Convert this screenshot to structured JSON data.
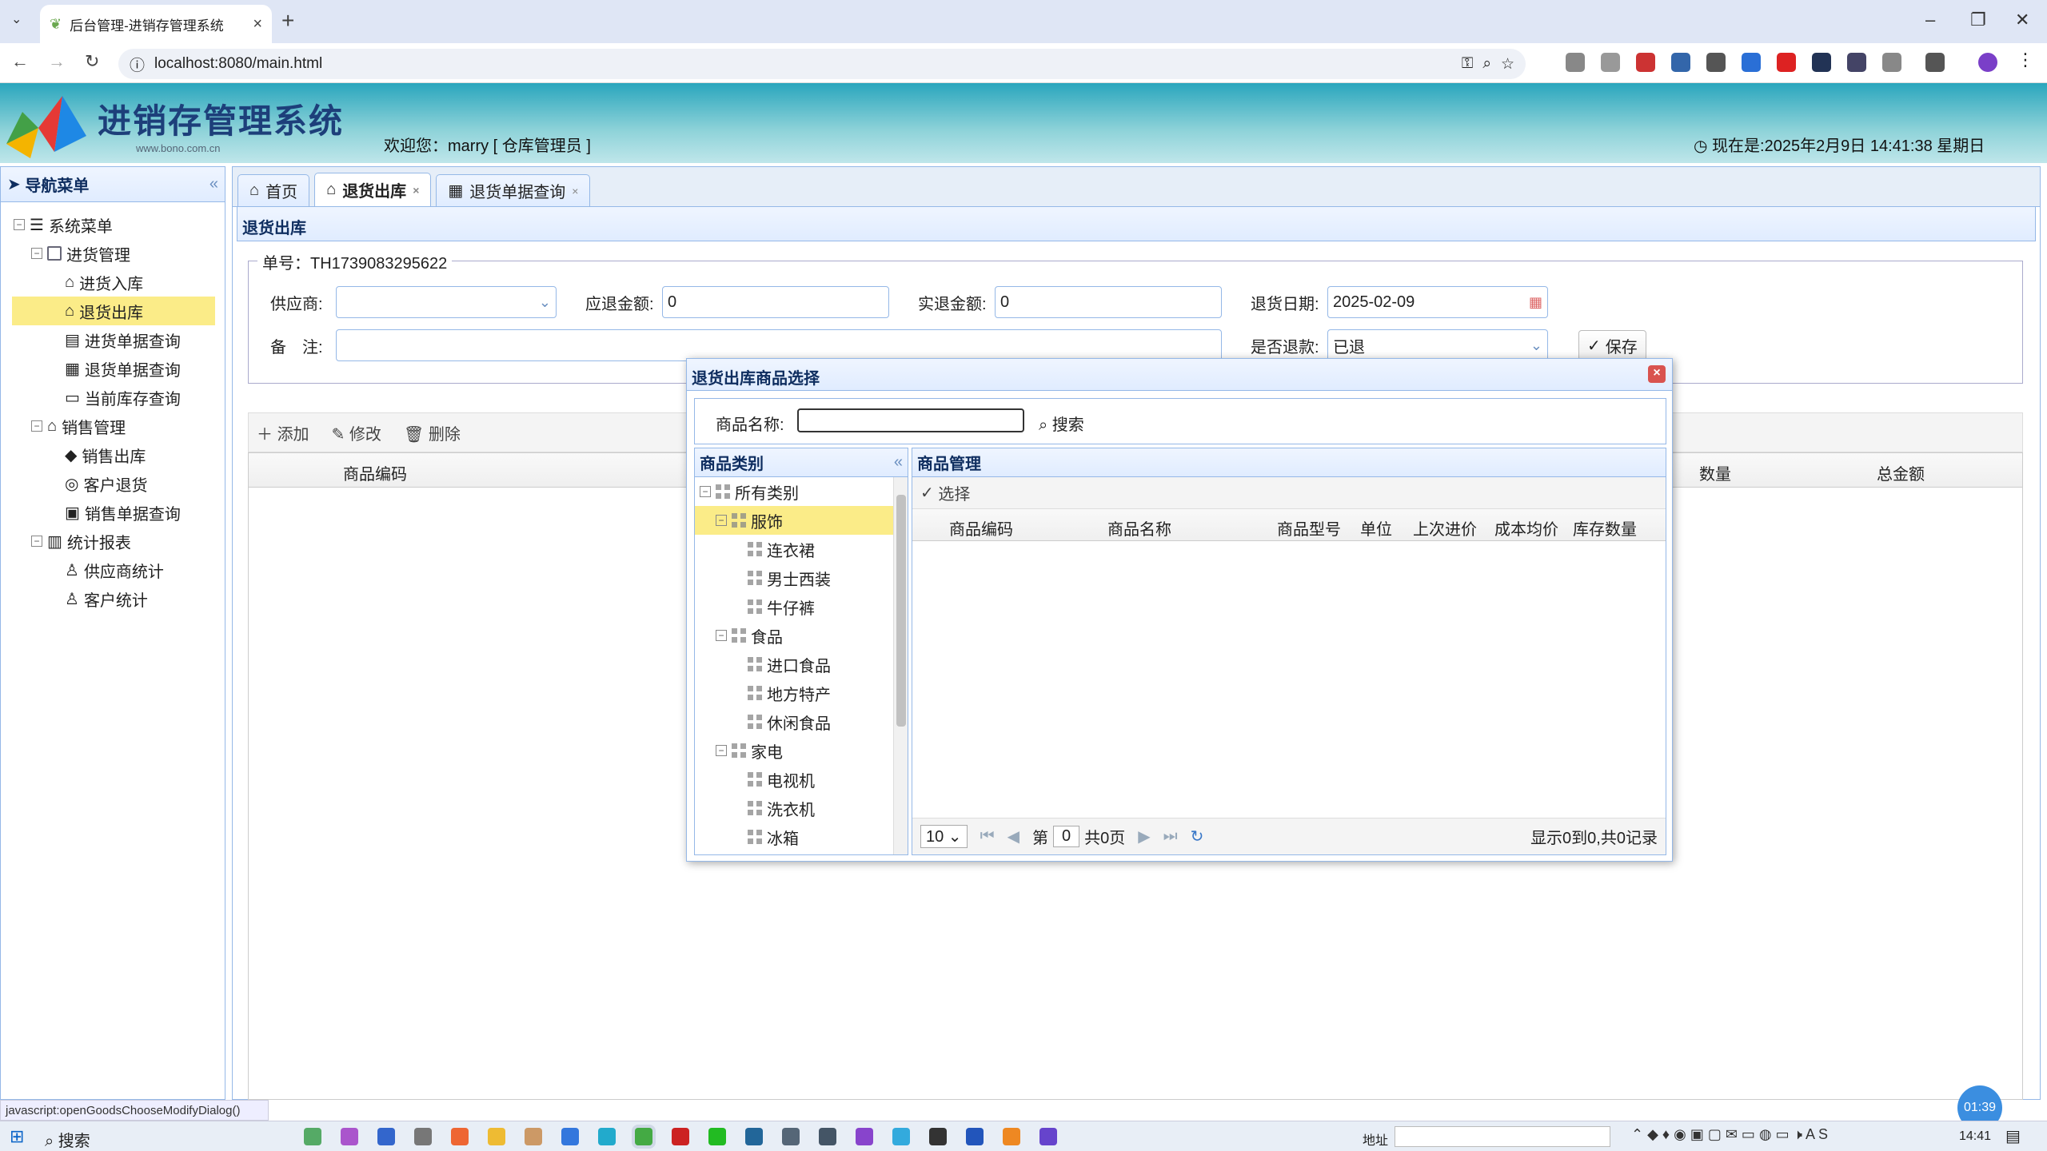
{
  "browser": {
    "tab_title": "后台管理-进销存管理系统",
    "url": "localhost:8080/main.html"
  },
  "header": {
    "title": "进销存管理系统",
    "site": "www.bono.com.cn",
    "welcome": "欢迎您：marry [ 仓库管理员 ]",
    "clock": "现在是:2025年2月9日 14:41:38 星期日"
  },
  "sidebar": {
    "title": "导航菜单",
    "items": [
      {
        "label": "系统菜单"
      },
      {
        "label": "进货管理"
      },
      {
        "label": "进货入库"
      },
      {
        "label": "退货出库"
      },
      {
        "label": "进货单据查询"
      },
      {
        "label": "退货单据查询"
      },
      {
        "label": "当前库存查询"
      },
      {
        "label": "销售管理"
      },
      {
        "label": "销售出库"
      },
      {
        "label": "客户退货"
      },
      {
        "label": "销售单据查询"
      },
      {
        "label": "统计报表"
      },
      {
        "label": "供应商统计"
      },
      {
        "label": "客户统计"
      }
    ]
  },
  "tabs": [
    {
      "label": "首页"
    },
    {
      "label": "退货出库"
    },
    {
      "label": "退货单据查询"
    }
  ],
  "content": {
    "title": "退货出库",
    "order_no": "单号：TH1739083295622",
    "supplier_label": "供应商:",
    "due_label": "应退金额:",
    "due_value": "0",
    "paid_label": "实退金额:",
    "paid_value": "0",
    "date_label": "退货日期:",
    "date_value": "2025-02-09",
    "remark_label": "备　注:",
    "refund_label": "是否退款:",
    "refund_value": "已退",
    "save": "保存"
  },
  "toolbar": {
    "add": "添加",
    "edit": "修改",
    "delete": "删除"
  },
  "grid": {
    "col_code": "商品编码",
    "col_qty": "数量",
    "col_total": "总金额"
  },
  "dialog": {
    "title": "退货出库商品选择",
    "name_label": "商品名称:",
    "search": "搜索",
    "cat_title": "商品类别",
    "goods_title": "商品管理",
    "select": "选择",
    "categories": [
      {
        "label": "所有类别"
      },
      {
        "label": "服饰"
      },
      {
        "label": "连衣裙"
      },
      {
        "label": "男士西装"
      },
      {
        "label": "牛仔裤"
      },
      {
        "label": "食品"
      },
      {
        "label": "进口食品"
      },
      {
        "label": "地方特产"
      },
      {
        "label": "休闲食品"
      },
      {
        "label": "家电"
      },
      {
        "label": "电视机"
      },
      {
        "label": "洗衣机"
      },
      {
        "label": "冰箱"
      }
    ],
    "columns": [
      "商品编码",
      "商品名称",
      "商品型号",
      "单位",
      "上次进价",
      "成本均价",
      "库存数量"
    ],
    "page_size": "10",
    "page_prefix": "第",
    "page_value": "0",
    "page_total": "共0页",
    "summary": "显示0到0,共0记录"
  },
  "statusbar": "javascript:openGoodsChooseModifyDialog()",
  "taskbar": {
    "search": "搜索",
    "addr": "地址",
    "time": "14:41"
  },
  "timer": "01:39"
}
